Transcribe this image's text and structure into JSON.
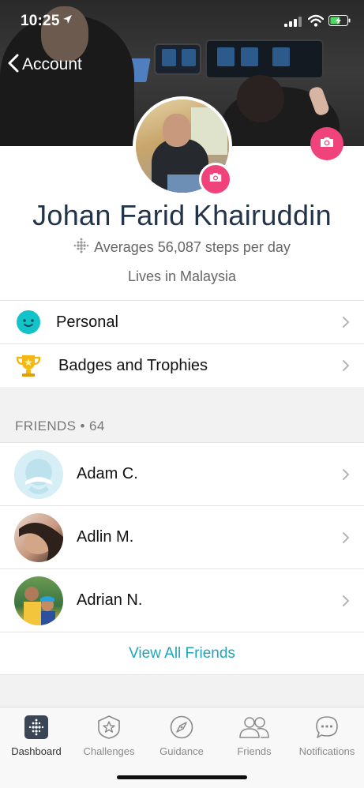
{
  "status_bar": {
    "time": "10:25"
  },
  "header": {
    "back_label": "Account"
  },
  "profile": {
    "name": "Johan Farid Khairuddin",
    "steps_text": "Averages 56,087 steps per day",
    "location_text": "Lives in Malaysia"
  },
  "menu": {
    "items": [
      {
        "label": "Personal",
        "icon": "smiley-face-icon"
      },
      {
        "label": "Badges and Trophies",
        "icon": "trophy-icon"
      }
    ]
  },
  "friends": {
    "header": "FRIENDS • 64",
    "items": [
      {
        "name": "Adam C."
      },
      {
        "name": "Adlin M."
      },
      {
        "name": "Adrian N."
      }
    ],
    "view_all_label": "View All Friends"
  },
  "tabbar": {
    "tabs": [
      {
        "label": "Dashboard",
        "icon": "dashboard-icon",
        "active": true
      },
      {
        "label": "Challenges",
        "icon": "challenges-star-icon",
        "active": false
      },
      {
        "label": "Guidance",
        "icon": "compass-icon",
        "active": false
      },
      {
        "label": "Friends",
        "icon": "friends-icon",
        "active": false
      },
      {
        "label": "Notifications",
        "icon": "chat-bubble-icon",
        "active": false
      }
    ]
  },
  "colors": {
    "accent_pink": "#f0437b",
    "link_teal": "#1fa6b4",
    "name_navy": "#23344a"
  }
}
